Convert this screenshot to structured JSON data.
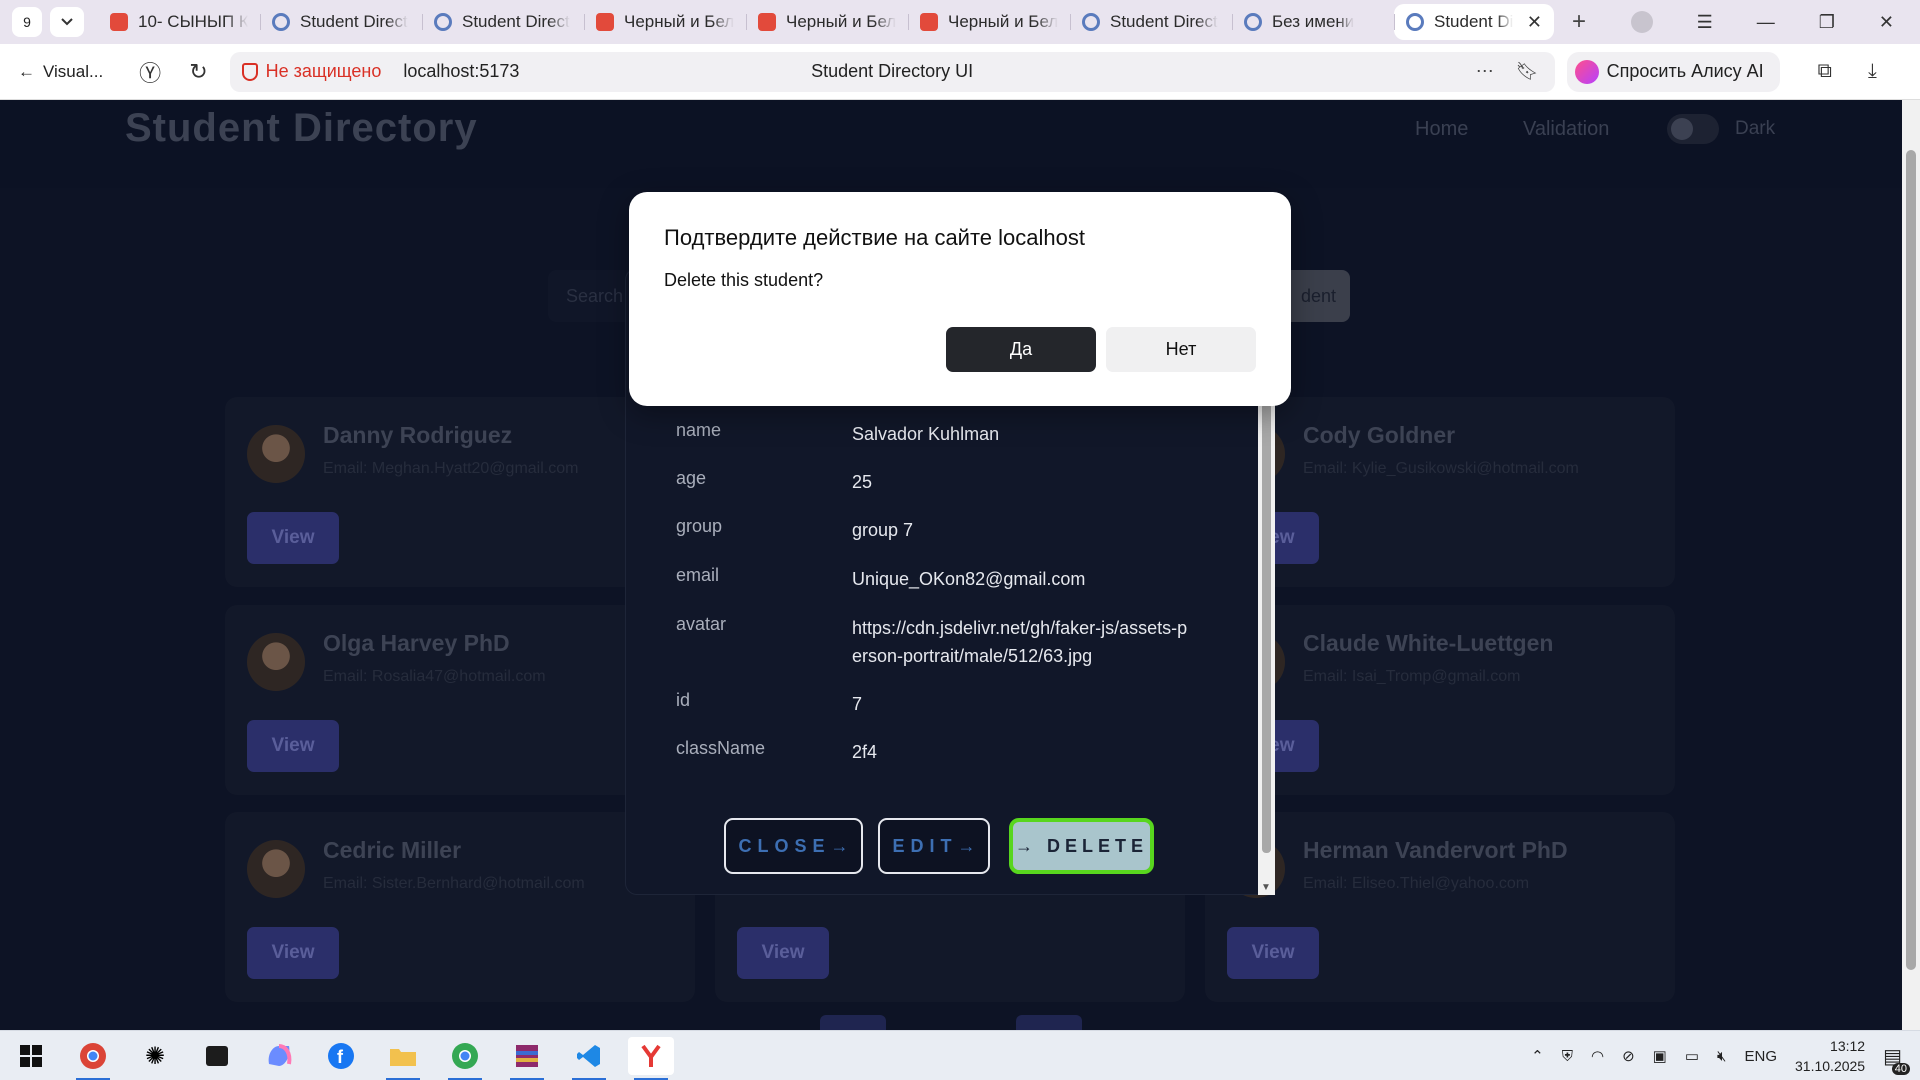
{
  "browser": {
    "tab_count": "9",
    "tabs": [
      {
        "label": "10- СЫНЫП К",
        "icon": "red"
      },
      {
        "label": "Student Direct",
        "icon": "gear"
      },
      {
        "label": "Student Direct",
        "icon": "gear"
      },
      {
        "label": "Черный и Бел",
        "icon": "red"
      },
      {
        "label": "Черный и Бел",
        "icon": "red"
      },
      {
        "label": "Черный и Бел",
        "icon": "red"
      },
      {
        "label": "Student Direct",
        "icon": "gear"
      },
      {
        "label": "Без имени",
        "icon": "gear"
      },
      {
        "label": "Student Di",
        "icon": "gear",
        "active": true
      }
    ],
    "back_label": "Visual...",
    "security_label": "Не защищено",
    "url": "localhost:5173",
    "page_title": "Student Directory UI",
    "alice_label": "Спросить Алису AI"
  },
  "app": {
    "brand": "Student Directory",
    "nav": {
      "home": "Home",
      "validation": "Validation",
      "dark": "Dark"
    },
    "search_placeholder": "Search",
    "add_label": "dent",
    "cards": [
      {
        "name": "Danny Rodriguez",
        "email": "Email: Meghan.Hyatt20@gmail.com",
        "view": "View"
      },
      {
        "name": "Cody Goldner",
        "email": "Email: Kylie_Gusikowski@hotmail.com",
        "view": "View"
      },
      {
        "name": "Olga Harvey PhD",
        "email": "Email: Rosalia47@hotmail.com",
        "view": "View"
      },
      {
        "name": "Claude White-Luettgen",
        "email": "Email: Isai_Tromp@gmail.com",
        "view": "View"
      },
      {
        "name": "Cedric Miller",
        "email": "Email: Sister.Bernhard@hotmail.com",
        "view": "View"
      },
      {
        "name": "Herman Vandervort PhD",
        "email": "Email: Eliseo.Thiel@yahoo.com",
        "view": "View"
      }
    ],
    "mid_view": "View"
  },
  "student_modal": {
    "fields": [
      {
        "key": "name",
        "value": "Salvador Kuhlman"
      },
      {
        "key": "age",
        "value": "25"
      },
      {
        "key": "group",
        "value": "group 7"
      },
      {
        "key": "email",
        "value": "Unique_OKon82@gmail.com"
      },
      {
        "key": "avatar",
        "value": "https://cdn.jsdelivr.net/gh/faker-js/assets-person-portrait/male/512/63.jpg"
      },
      {
        "key": "id",
        "value": "7"
      },
      {
        "key": "className",
        "value": "2f4"
      }
    ],
    "close_label": "CLOSE",
    "edit_label": "EDIT",
    "delete_label": "DELETE"
  },
  "confirm_dialog": {
    "title": "Подтвердите действие на сайте localhost",
    "message": "Delete this student?",
    "yes_label": "Да",
    "no_label": "Нет"
  },
  "taskbar": {
    "language": "ENG",
    "time": "13:12",
    "date": "31.10.2025",
    "notifications": "40"
  }
}
